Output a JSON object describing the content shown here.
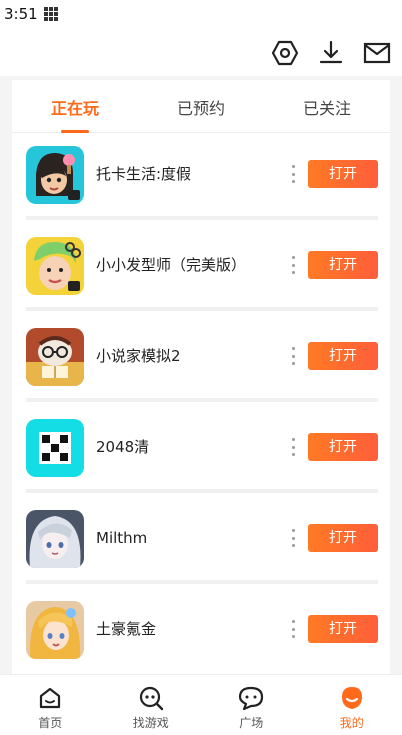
{
  "status_bar": {
    "time": "3:51"
  },
  "tabs": [
    {
      "label": "正在玩",
      "active": true
    },
    {
      "label": "已预约",
      "active": false
    },
    {
      "label": "已关注",
      "active": false
    }
  ],
  "games": [
    {
      "name": "托卡生活:度假",
      "button": "打开",
      "icon": "toca-life-vacation-icon"
    },
    {
      "name": "小小发型师（完美版）",
      "button": "打开",
      "icon": "hair-stylist-icon"
    },
    {
      "name": "小说家模拟2",
      "button": "打开",
      "icon": "novelist-sim-icon"
    },
    {
      "name": "2048清",
      "button": "打开",
      "icon": "2048-icon"
    },
    {
      "name": "Milthm",
      "button": "打开",
      "icon": "milthm-icon"
    },
    {
      "name": "土豪氪金",
      "button": "打开",
      "icon": "tuhao-kejin-icon"
    }
  ],
  "bottom_nav": [
    {
      "label": "首页",
      "icon": "home-icon"
    },
    {
      "label": "找游戏",
      "icon": "find-game-icon"
    },
    {
      "label": "广场",
      "icon": "square-chat-icon"
    },
    {
      "label": "我的",
      "icon": "profile-icon",
      "active": true
    }
  ],
  "colors": {
    "accent": "#ff6a1a",
    "button_gradient_start": "#ff7a24",
    "button_gradient_end": "#ff5e3a"
  }
}
